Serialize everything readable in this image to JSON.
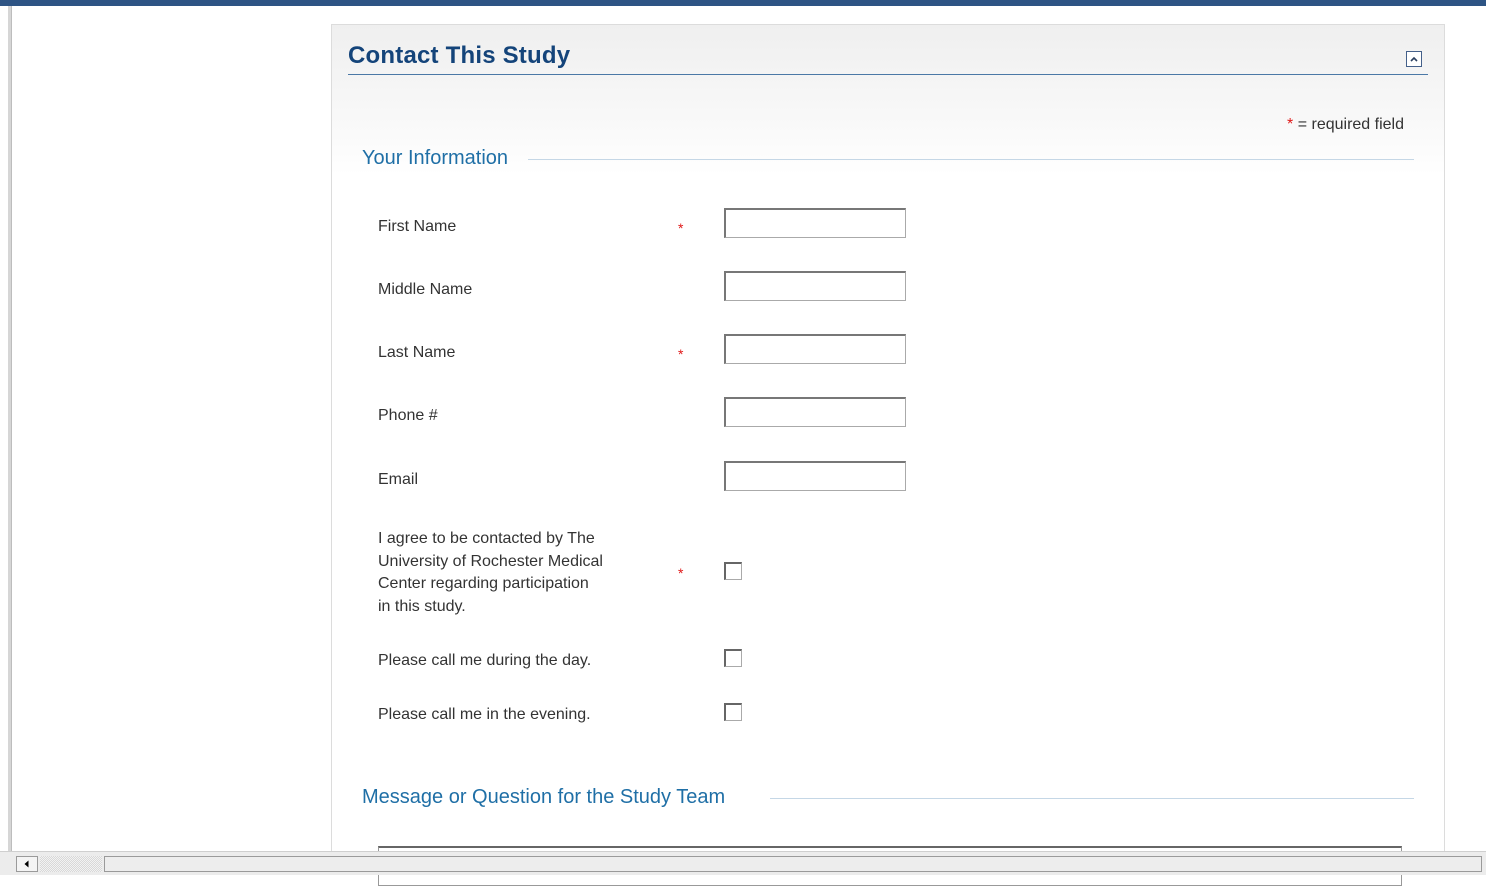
{
  "panel": {
    "title": "Contact This Study",
    "required_star": "*",
    "required_note": "= required field"
  },
  "sections": {
    "your_info": "Your Information",
    "message": "Message or Question for the Study Team"
  },
  "fields": {
    "first_name": {
      "label": "First Name",
      "required": "*",
      "value": ""
    },
    "middle_name": {
      "label": "Middle Name",
      "value": ""
    },
    "last_name": {
      "label": "Last Name",
      "required": "*",
      "value": ""
    },
    "phone": {
      "label": "Phone #",
      "value": ""
    },
    "email": {
      "label": "Email",
      "value": ""
    },
    "agree": {
      "label_lines": [
        "I agree to be contacted by The",
        "University of Rochester Medical",
        "Center regarding participation",
        "in this study."
      ],
      "required": "*",
      "checked": false
    },
    "call_day": {
      "label": "Please call me during the day.",
      "checked": false
    },
    "call_evening": {
      "label": "Please call me in the evening.",
      "checked": false
    }
  },
  "icons": {
    "collapse": "chevron-up-icon",
    "scroll_left": "arrow-left-icon"
  },
  "colors": {
    "title": "#14447a",
    "section_heading": "#1f6fa6",
    "required": "#e01818",
    "top_bar": "#2e5484"
  }
}
